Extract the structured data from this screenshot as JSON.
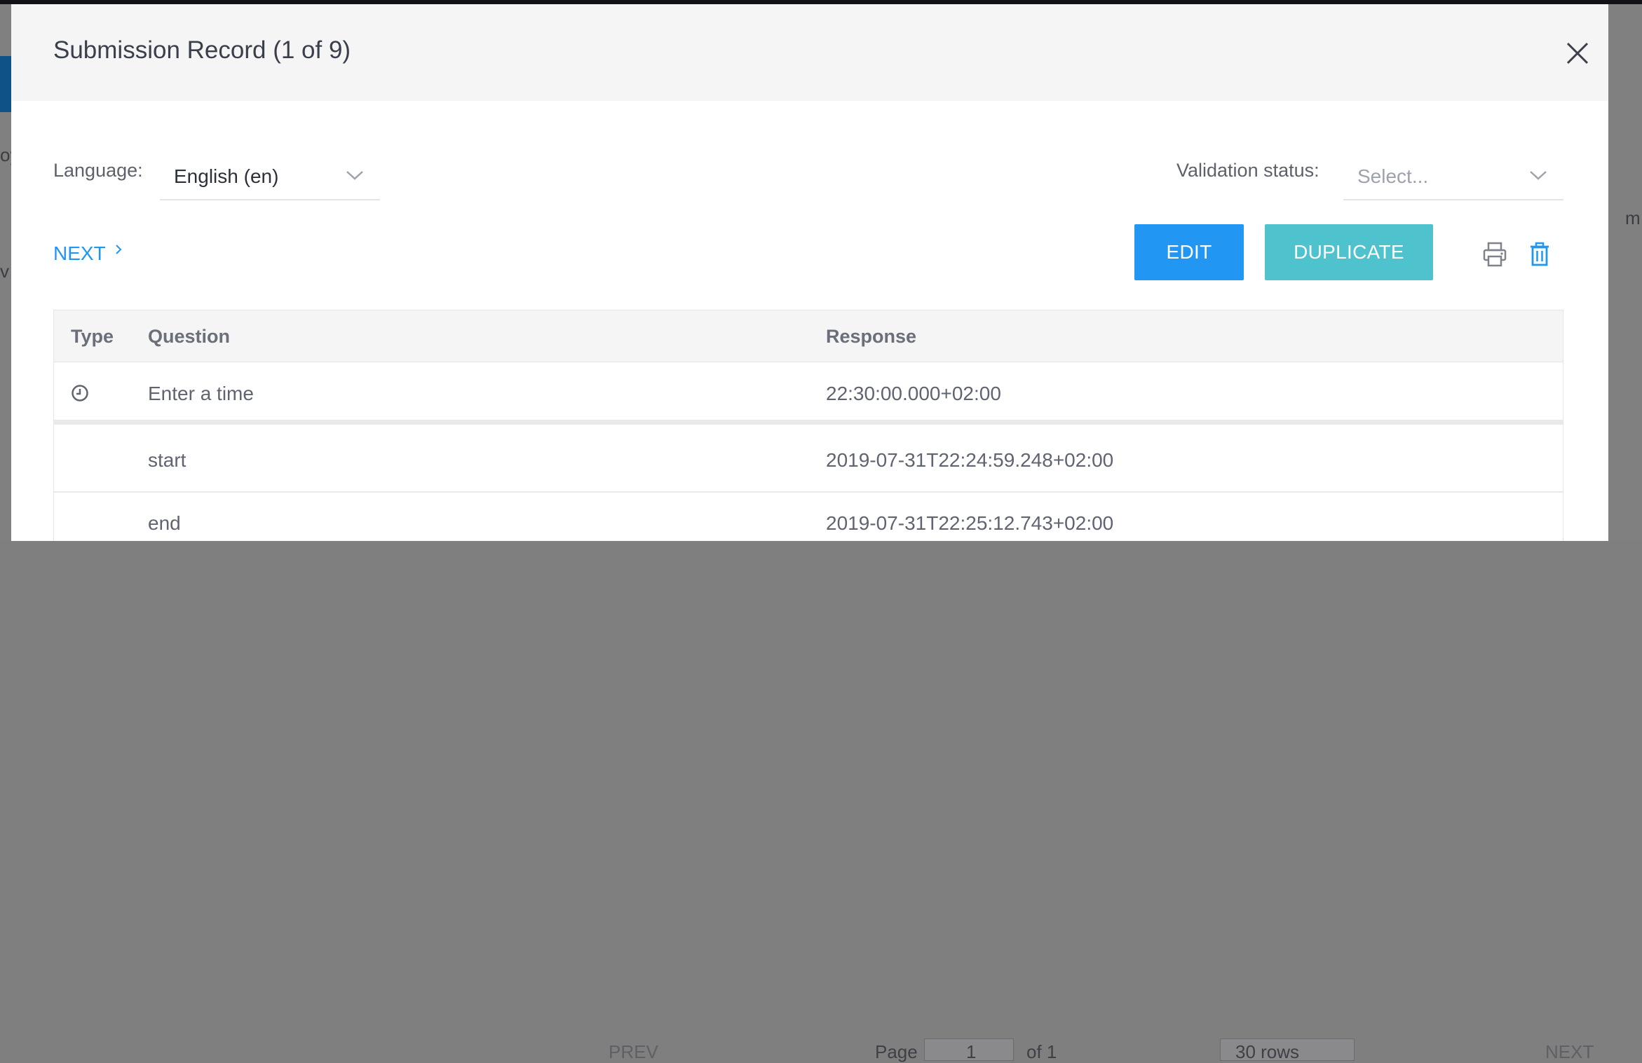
{
  "background": {
    "fragments": [
      "oy",
      "v",
      "m"
    ],
    "pager": {
      "prev_label": "PREV",
      "page_label": "Page",
      "page_value": "1",
      "of_label": "of 1",
      "rows_value": "30 rows",
      "next_label": "NEXT"
    }
  },
  "modal": {
    "title": "Submission Record (1 of 9)",
    "language": {
      "label": "Language:",
      "value": "English (en)"
    },
    "validation": {
      "label": "Validation status:",
      "placeholder": "Select..."
    },
    "next_link": "NEXT",
    "buttons": {
      "edit": "EDIT",
      "duplicate": "DUPLICATE"
    },
    "table": {
      "headers": {
        "type": "Type",
        "question": "Question",
        "response": "Response"
      },
      "rows": [
        {
          "type_icon": "clock-icon",
          "question": "Enter a time",
          "response": "22:30:00.000+02:00"
        },
        {
          "type_icon": "",
          "question": "start",
          "response": "2019-07-31T22:24:59.248+02:00"
        },
        {
          "type_icon": "",
          "question": "end",
          "response": "2019-07-31T22:25:12.743+02:00"
        }
      ]
    }
  },
  "colors": {
    "primary": "#2196f3",
    "duplicate": "#4fc3cd",
    "link": "#2095f2",
    "header_bg": "#f5f5f5",
    "overlay": "#808081"
  }
}
